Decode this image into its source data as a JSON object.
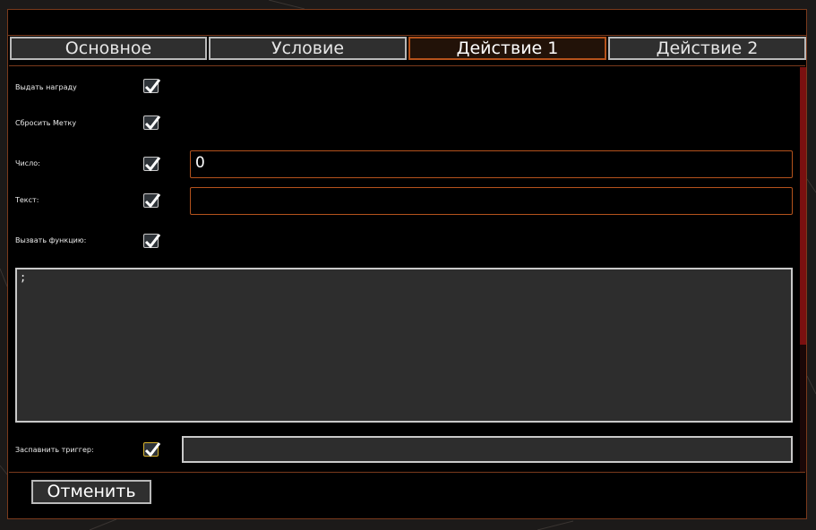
{
  "tabs": [
    {
      "label": "Основное",
      "active": false
    },
    {
      "label": "Условие",
      "active": false
    },
    {
      "label": "Действие 1",
      "active": true
    },
    {
      "label": "Действие 2",
      "active": false
    }
  ],
  "rows": {
    "give_reward": {
      "label": "Выдать награду",
      "checked": true
    },
    "reset_mark": {
      "label": "Сбросить Метку",
      "checked": true
    },
    "number": {
      "label": "Число:",
      "checked": true,
      "value": "0"
    },
    "text": {
      "label": "Текст:",
      "checked": true,
      "value": ""
    },
    "call_function": {
      "label": "Вызвать функцию:",
      "checked": true
    },
    "fire_trigger": {
      "label": "Заспавнить триггер:",
      "checked": true,
      "value": ""
    }
  },
  "code": {
    "value": ";"
  },
  "footer": {
    "cancel_label": "Отменить"
  },
  "colors": {
    "accent": "#b5521b",
    "frame": "#7a3a1c",
    "scroll_thumb": "#7a1010",
    "checkbox_highlight": "#d6b12c"
  }
}
